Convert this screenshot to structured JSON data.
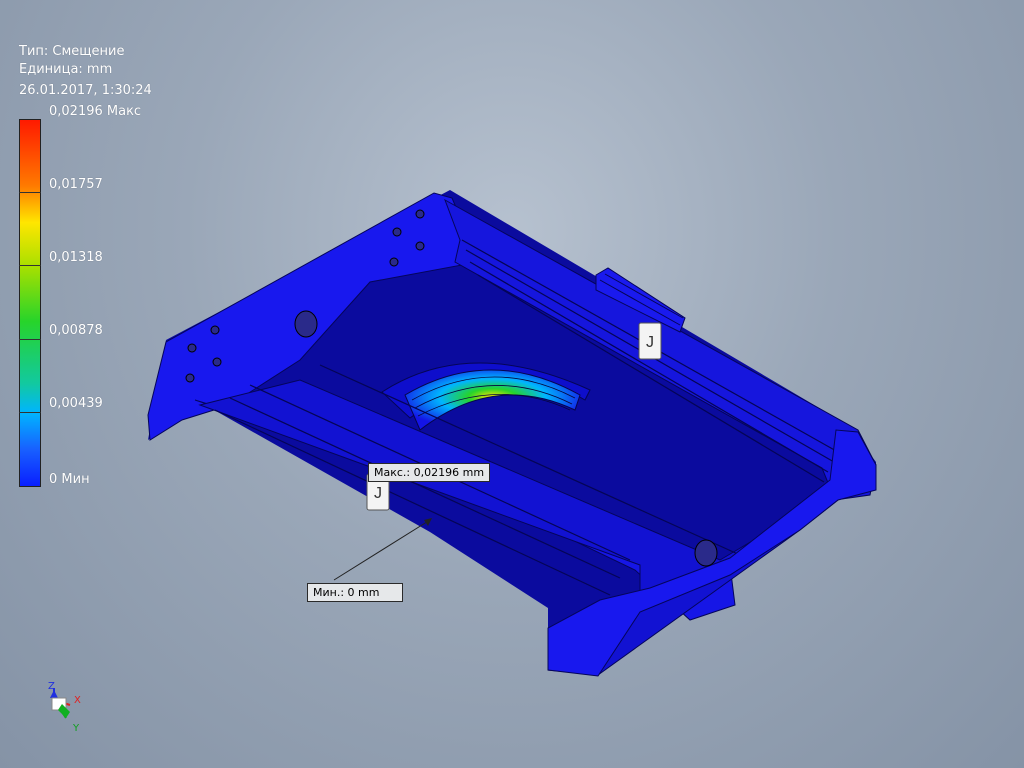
{
  "legend": {
    "type_line": "Тип: Смещение",
    "unit_line": "Единица: mm",
    "date_line": "26.01.2017, 1:30:24",
    "ticks": [
      "0,02196 Макс",
      "0,01757",
      "0,01318",
      "0,00878",
      "0,00439",
      "0 Мин"
    ],
    "colors": [
      "#ff1a00",
      "#ff7a00",
      "#ffe600",
      "#a8e000",
      "#27d42a",
      "#12c9a0",
      "#00b5ff",
      "#1860ff",
      "#0a1fff"
    ]
  },
  "callouts": {
    "max_label": "Макс.: 0,02196 mm",
    "min_label": "Мин.: 0 mm"
  },
  "axes": {
    "z": "Z",
    "x": "X",
    "y": "Y"
  },
  "colors": {
    "model_blue": "#1414e6",
    "model_dark": "#0b0b9e"
  }
}
